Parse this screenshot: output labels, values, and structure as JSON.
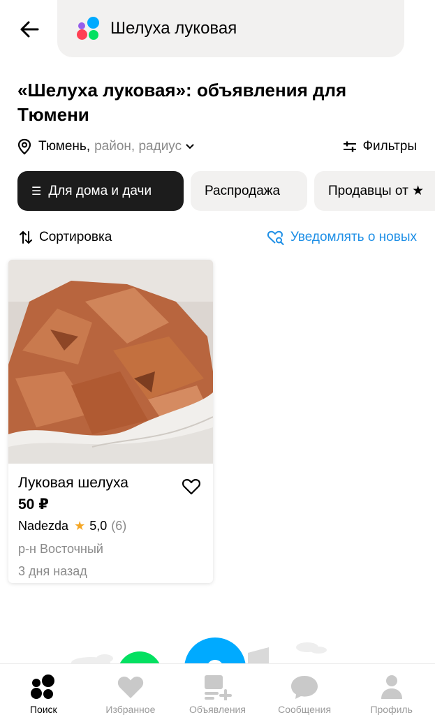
{
  "search": {
    "query": "Шелуха луковая"
  },
  "title": "«Шелуха луковая»: объявления для Тюмени",
  "location": {
    "city": "Тюмень,",
    "rest": "район, радиус"
  },
  "filters_label": "Фильтры",
  "chips": [
    {
      "label": "Для дома и дачи",
      "active": true
    },
    {
      "label": "Распродажа",
      "active": false
    },
    {
      "label": "Продавцы от ★",
      "active": false
    }
  ],
  "sort_label": "Сортировка",
  "notify_label": "Уведомлять о новых",
  "listing": {
    "title": "Луковая шелуха",
    "price": "50 ₽",
    "seller": "Nadezda",
    "rating": "5,0",
    "reviews": "(6)",
    "district": "р-н Восточный",
    "date": "3 дня назад"
  },
  "tabs": [
    {
      "label": "Поиск",
      "icon": "search-dots-icon",
      "active": true
    },
    {
      "label": "Избранное",
      "icon": "heart-icon",
      "active": false
    },
    {
      "label": "Объявления",
      "icon": "ads-icon",
      "active": false
    },
    {
      "label": "Сообщения",
      "icon": "chat-icon",
      "active": false
    },
    {
      "label": "Профиль",
      "icon": "profile-icon",
      "active": false
    }
  ],
  "colors": {
    "accent": "#1e8fe6",
    "chip_active": "#1c1c1c",
    "chip_bg": "#f2f1f0",
    "star": "#f5a623"
  }
}
